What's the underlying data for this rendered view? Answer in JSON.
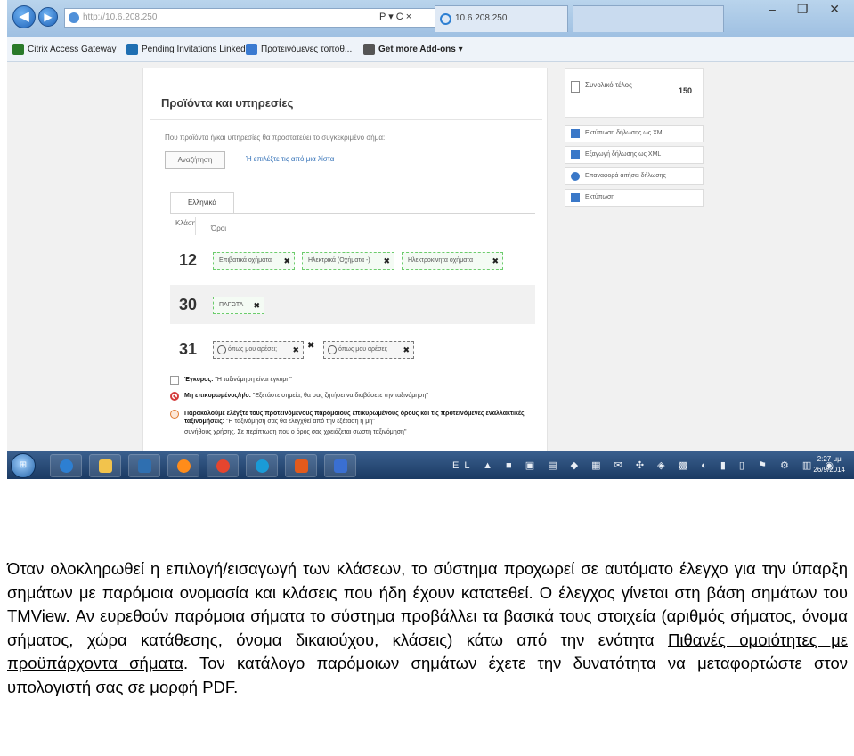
{
  "browser": {
    "address_fragment": "http://10.6.208.250",
    "address_secondary": "10.6.208.250",
    "address_controls": "P ▾ C ×",
    "tab_title": "",
    "window_controls": "– ❐ ✕"
  },
  "favorites": [
    {
      "label": "Citrix Access Gateway",
      "color": "#2a7a2a"
    },
    {
      "label": "Pending Invitations LinkedIn",
      "color": "#1f6fb2"
    },
    {
      "label": "Προτεινόμενες τοποθ...",
      "color": "#3b7bd1"
    },
    {
      "label": "Get more Add-ons ▾",
      "color": "#555555"
    }
  ],
  "panel": {
    "title": "Προϊόντα και υπηρεσίες",
    "instructions": "Που προϊόντα ή/και υπηρεσίες θα προστατεύει το συγκεκριμένο σήμα:",
    "search_button": "Αναζήτηση",
    "link": "Ή επιλέξτε τις από μια λίστα",
    "tab_products": "Ελληνικά",
    "col_class": "Κλάση",
    "col_terms": "Όροι",
    "classes": [
      {
        "number": "12",
        "chips": [
          "Επιβατικά οχήματα",
          "Ηλεκτρικά (Οχήματα -)",
          "Ηλεκτροκίνητα οχήματα"
        ],
        "alt": false
      },
      {
        "number": "30",
        "chips": [
          "ΠΑΓΩΤΑ"
        ],
        "alt": false
      },
      {
        "number": "31",
        "chips": [
          "όπως μου αρέσει;",
          "όπως μου αρέσει;"
        ],
        "alt": true
      }
    ],
    "messages": [
      {
        "type": "check",
        "bold": "Έγκυρος:",
        "text": " \"Η ταξινόμηση είναι έγκυρη\""
      },
      {
        "type": "stop",
        "bold": "Μη επικυρωμένος/η/ο:",
        "text": " \"Εξετάστε σημεία, θα σας ζητήσει να διαβάσετε την ταξινόμηση\""
      },
      {
        "type": "warn",
        "bold": "Παρακαλούμε ελέγξτε τους προτεινόμενους παρόμοιους επικυρωμένους όρους και τις προτεινόμενες εναλλακτικές ταξινομήσεις:",
        "text": " \"Η ταξινόμηση σας θα ελεγχθεί από την εξέταση ή μη\""
      },
      {
        "type": "none",
        "bold": "",
        "text": "συνήθους χρήσης. Σε περίπτωση που ο όρος σας χρειάζεται σωστή ταξινόμηση\""
      }
    ]
  },
  "side": {
    "total_label": "Συνολικό τέλος",
    "total_value": "150",
    "actions": [
      {
        "label": "Εκτύπωση δήλωσης ως XML",
        "color": "#3a78c8"
      },
      {
        "label": "Εξαγωγή δήλωσης ως XML",
        "color": "#3a78c8"
      },
      {
        "label": "Επαναφορά αιτήσει δήλωσης",
        "color": "#3a78c8"
      },
      {
        "label": "Εκτύπωση",
        "color": "#3a78c8"
      }
    ]
  },
  "taskbar": {
    "start_label": "⊞",
    "apps": [
      "#2d7fd2",
      "#f2c34c",
      "#2f6fb0",
      "#ff8c1a",
      "#e5452e",
      "#1a9bd7",
      "#e25a1c",
      "#3a6fd1"
    ],
    "tray": "EL ▲ ■ ▣ ▤ ◆ ▦ ✉ ✣ ◈ ▩ ◐ ▮ ▯ ⚑ ⚙ ▥ ◉",
    "time": "2:27 μμ",
    "date": "26/9/2014"
  },
  "caption": {
    "part1": "Όταν ολοκληρωθεί η επιλογή/εισαγωγή των κλάσεων, το σύστημα προχωρεί σε αυτόματο έλεγχο για την ύπαρξη σημάτων με παρόμοια ονομασία και κλάσεις που ήδη έχουν κατατεθεί. Ο έλεγχος γίνεται στη βάση σημάτων του TMView. Αν ευρεθούν παρόμοια σήματα το σύστημα προβάλλει τα βασικά τους στοιχεία (αριθμός σήματος, όνομα σήματος, χώρα κατάθεσης, όνομα δικαιούχου, κλάσεις) κάτω από την ενότητα ",
    "underlined": "Πιθανές ομοιότητες με προϋπάρχοντα σήματα",
    "part2": ". Τον κατάλογο παρόμοιων σημάτων έχετε την δυνατότητα να μεταφορτώστε στον υπολογιστή σας σε μορφή PDF."
  }
}
